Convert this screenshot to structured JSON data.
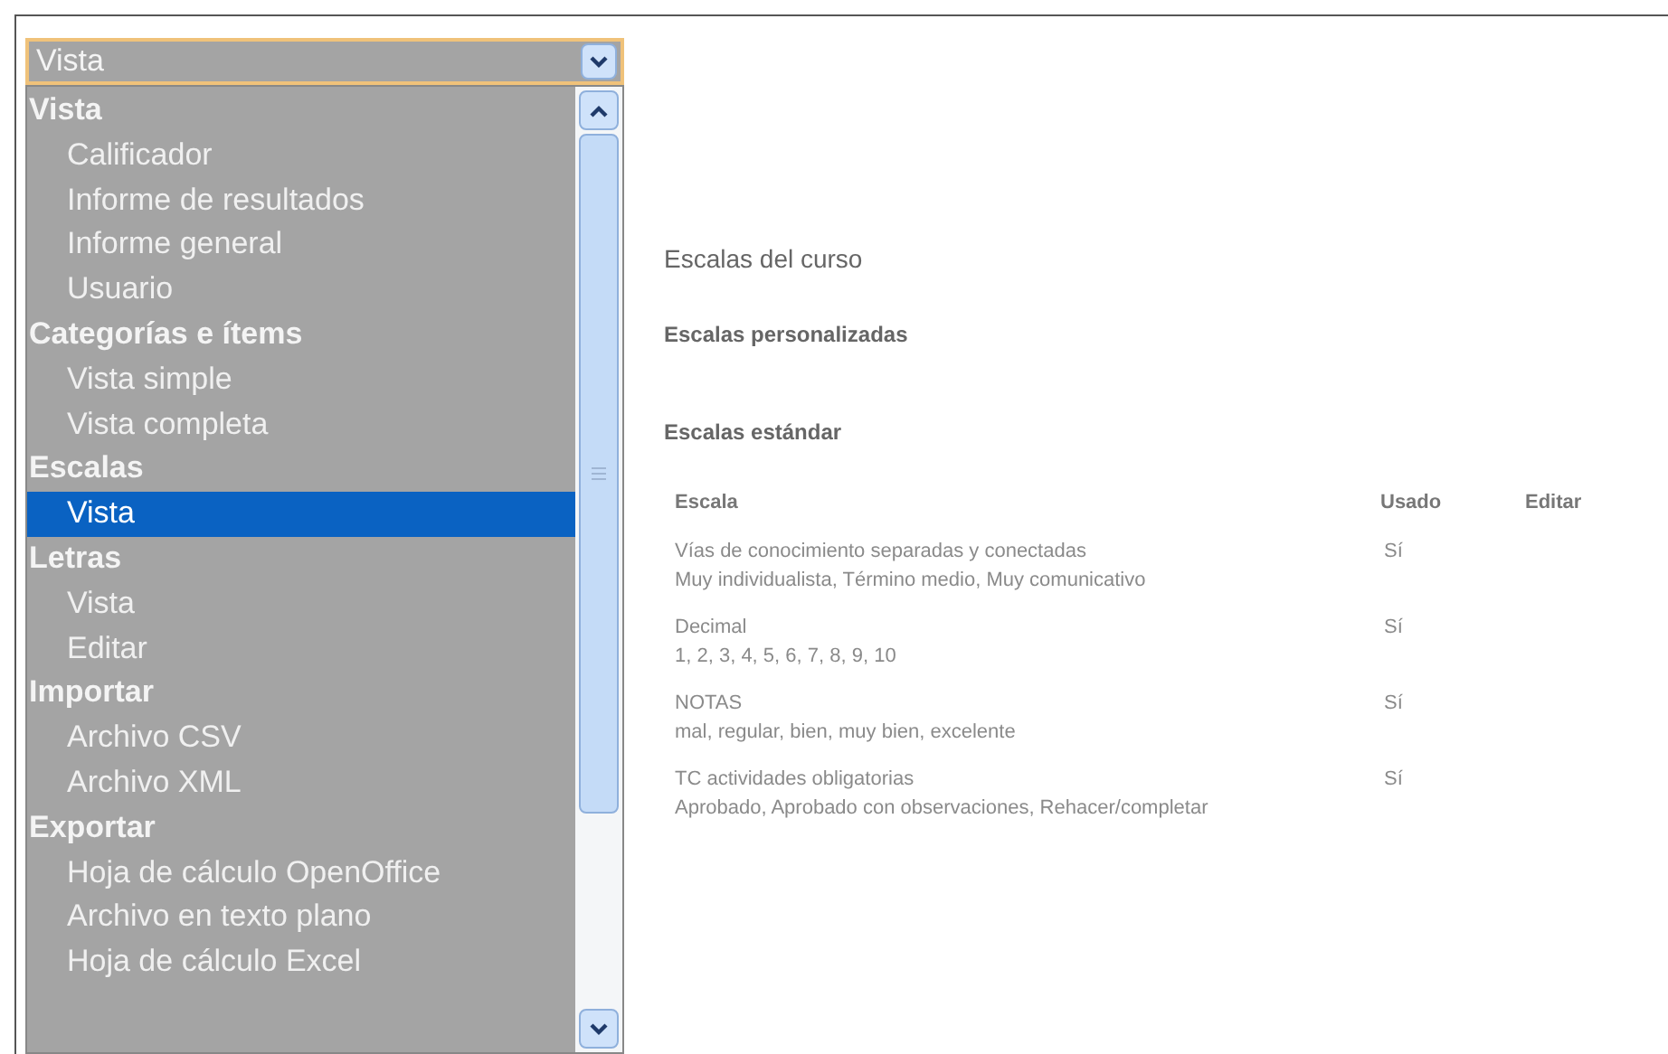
{
  "select": {
    "value": "Vista",
    "expanded": true
  },
  "dropdown": [
    {
      "label": "Vista",
      "children": [
        {
          "label": "Calificador",
          "selected": false
        },
        {
          "label": "Informe de resultados",
          "selected": false
        },
        {
          "label": "Informe general",
          "selected": false
        },
        {
          "label": "Usuario",
          "selected": false
        }
      ]
    },
    {
      "label": "Categorías e ítems",
      "children": [
        {
          "label": "Vista simple",
          "selected": false
        },
        {
          "label": "Vista completa",
          "selected": false
        }
      ]
    },
    {
      "label": "Escalas",
      "children": [
        {
          "label": "Vista",
          "selected": true
        }
      ]
    },
    {
      "label": "Letras",
      "children": [
        {
          "label": "Vista",
          "selected": false
        },
        {
          "label": "Editar",
          "selected": false
        }
      ]
    },
    {
      "label": "Importar",
      "children": [
        {
          "label": "Archivo CSV",
          "selected": false
        },
        {
          "label": "Archivo XML",
          "selected": false
        }
      ]
    },
    {
      "label": "Exportar",
      "children": [
        {
          "label": "Hoja de cálculo OpenOffice",
          "selected": false
        },
        {
          "label": "Archivo en texto plano",
          "selected": false
        },
        {
          "label": "Hoja de cálculo Excel",
          "selected": false
        }
      ]
    }
  ],
  "content": {
    "title": "Escalas del curso",
    "custom_heading": "Escalas personalizadas",
    "standard_heading": "Escalas estándar",
    "table": {
      "columns": [
        "Escala",
        "Usado",
        "Editar"
      ],
      "rows": [
        {
          "name": "Vías de conocimiento separadas y conectadas",
          "values": "Muy individualista, Término medio, Muy comunicativo",
          "used": "Sí"
        },
        {
          "name": "Decimal",
          "values": "1, 2, 3, 4, 5, 6, 7, 8, 9, 10",
          "used": "Sí"
        },
        {
          "name": "NOTAS",
          "values": "mal, regular, bien, muy bien, excelente",
          "used": "Sí"
        },
        {
          "name": "TC actividades obligatorias",
          "values": "Aprobado, Aprobado con observaciones, Rehacer/completar",
          "used": "Sí"
        }
      ]
    }
  }
}
